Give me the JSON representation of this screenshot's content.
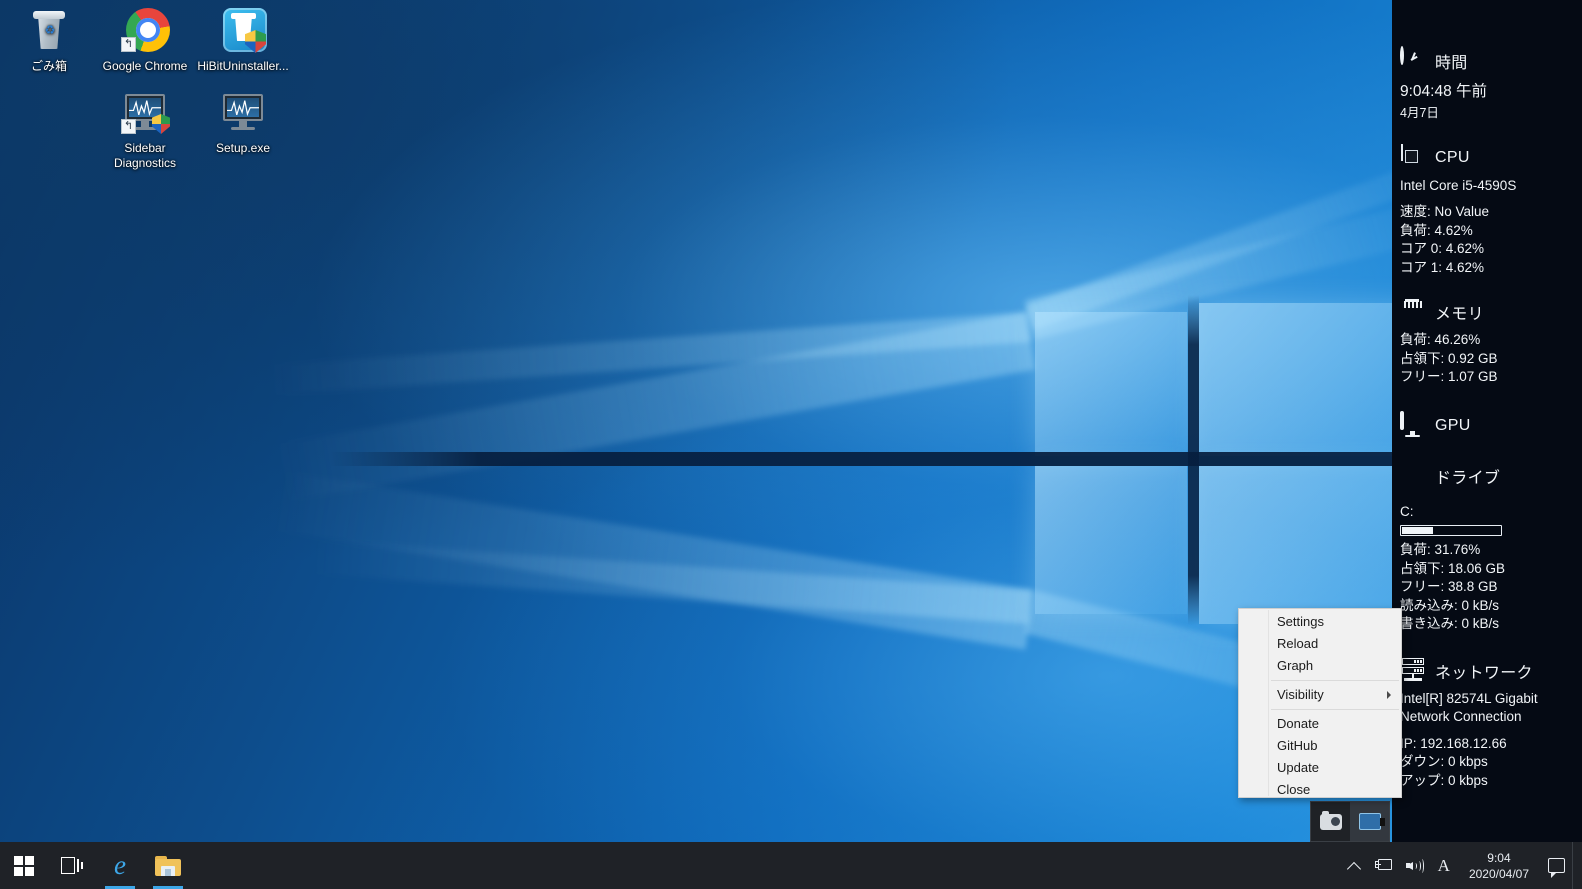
{
  "desktop": {
    "icons": [
      {
        "name": "recycle-bin",
        "label": "ごみ箱"
      },
      {
        "name": "google-chrome",
        "label": "Google Chrome"
      },
      {
        "name": "hibit-uninstaller",
        "label": "HiBitUninstaller..."
      },
      {
        "name": "sidebar-diagnostics",
        "label": "Sidebar\nDiagnostics"
      },
      {
        "name": "setup-exe",
        "label": "Setup.exe"
      }
    ]
  },
  "sidebar": {
    "time": {
      "title": "時間",
      "icon": "clock-icon",
      "clock": "9:04:48 午前",
      "date": "4月7日"
    },
    "cpu": {
      "title": "CPU",
      "icon": "cpu-chip-icon",
      "model": "Intel Core i5-4590S",
      "lines": [
        "速度: No Value",
        "負荷: 4.62%",
        "コア 0: 4.62%",
        "コア 1: 4.62%"
      ]
    },
    "memory": {
      "title": "メモリ",
      "icon": "ram-stick-icon",
      "lines": [
        "負荷: 46.26%",
        "占領下: 0.92 GB",
        "フリー: 1.07 GB"
      ]
    },
    "gpu": {
      "title": "GPU",
      "icon": "monitor-icon"
    },
    "drive": {
      "title": "ドライブ",
      "icon": "hard-drive-icon",
      "letter": "C:",
      "usage_percent": 31.76,
      "lines": [
        "負荷: 31.76%",
        "占領下: 18.06 GB",
        "フリー: 38.8 GB",
        "読み込み: 0 kB/s",
        "書き込み: 0 kB/s"
      ]
    },
    "network": {
      "title": "ネットワーク",
      "icon": "network-rack-icon",
      "adapter": "Intel[R] 82574L Gigabit Network Connection",
      "lines": [
        "IP: 192.168.12.66",
        "ダウン: 0 kbps",
        "アップ: 0 kbps"
      ]
    }
  },
  "context_menu": {
    "items": [
      {
        "label": "Settings",
        "submenu": false
      },
      {
        "label": "Reload",
        "submenu": false
      },
      {
        "label": "Graph",
        "submenu": false
      },
      {
        "separator": true
      },
      {
        "label": "Visibility",
        "submenu": true
      },
      {
        "separator": true
      },
      {
        "label": "Donate",
        "submenu": false
      },
      {
        "label": "GitHub",
        "submenu": false
      },
      {
        "label": "Update",
        "submenu": false
      },
      {
        "label": "Close",
        "submenu": false
      }
    ]
  },
  "tray_flyout": {
    "icons": [
      {
        "name": "snipping-tool-icon",
        "highlighted": false
      },
      {
        "name": "sidebar-diagnostics-tray-icon",
        "highlighted": true
      }
    ]
  },
  "taskbar": {
    "buttons": [
      {
        "name": "start-button",
        "icon": "windows-logo-icon",
        "active": false
      },
      {
        "name": "task-view-button",
        "icon": "task-view-icon",
        "active": false
      },
      {
        "name": "edge-button",
        "icon": "edge-icon",
        "active": true
      },
      {
        "name": "file-explorer-button",
        "icon": "folder-icon",
        "active": true
      }
    ],
    "tray": {
      "chevron": "show-hidden-icons",
      "network": "network-icon",
      "volume": "volume-icon",
      "ime": "A",
      "clock_time": "9:04",
      "clock_date": "2020/04/07",
      "notifications": "action-center-icon"
    }
  },
  "colors": {
    "sidebar_bg": "#050a14",
    "taskbar_bg": "#1f2227",
    "accent": "#3da7e8",
    "menu_bg": "#f1f1f1"
  }
}
